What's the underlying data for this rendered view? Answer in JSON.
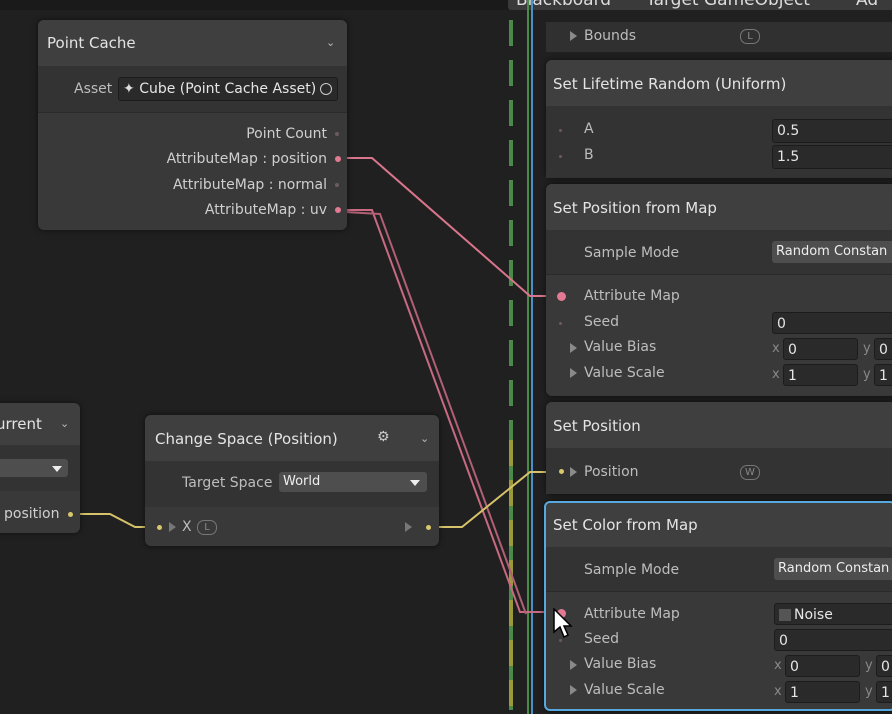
{
  "tabs": {
    "blackboard": "Blackboard",
    "target": "Target GameObject",
    "other": "Ad"
  },
  "point_cache": {
    "title": "Point Cache",
    "asset_label": "Asset",
    "asset_value": "Cube (Point Cache Asset)",
    "outputs": [
      "Point Count",
      "AttributeMap : position",
      "AttributeMap : normal",
      "AttributeMap : uv"
    ]
  },
  "left_node": {
    "title": "urrent",
    "output": "position"
  },
  "change_space": {
    "title": "Change Space (Position)",
    "target_label": "Target Space",
    "target_value": "World",
    "input_label": "X",
    "input_badge": "L"
  },
  "bounds": {
    "label": "Bounds",
    "badge": "L"
  },
  "lifetime": {
    "title": "Set Lifetime Random (Uniform)",
    "a_label": "A",
    "a_value": "0.5",
    "b_label": "B",
    "b_value": "1.5"
  },
  "set_pos_map": {
    "title": "Set Position from Map",
    "sample_mode_label": "Sample Mode",
    "sample_mode_value": "Random Constan",
    "attr_map_label": "Attribute Map",
    "seed_label": "Seed",
    "seed_value": "0",
    "bias_label": "Value Bias",
    "bias_x": "0",
    "bias_y": "0",
    "scale_label": "Value Scale",
    "scale_x": "1",
    "scale_y": "1",
    "x": "x",
    "y": "y"
  },
  "set_position": {
    "title": "Set Position",
    "position_label": "Position",
    "badge": "W"
  },
  "set_color_map": {
    "title": "Set Color from Map",
    "sample_mode_label": "Sample Mode",
    "sample_mode_value": "Random Constan",
    "attr_map_label": "Attribute Map",
    "attr_map_value": "Noise",
    "seed_label": "Seed",
    "seed_value": "0",
    "bias_label": "Value Bias",
    "bias_x": "0",
    "bias_y": "0",
    "scale_label": "Value Scale",
    "scale_x": "1",
    "scale_y": "1",
    "x": "x",
    "y": "y"
  },
  "colors": {
    "pink_edge": "#d9758c",
    "yellow_edge": "#d6c26a",
    "selection": "#58a8e0",
    "stripe_green": "#4c8a4c",
    "stripe_yellow": "#9a9a3a",
    "stripe_blue": "#4a90c8"
  }
}
